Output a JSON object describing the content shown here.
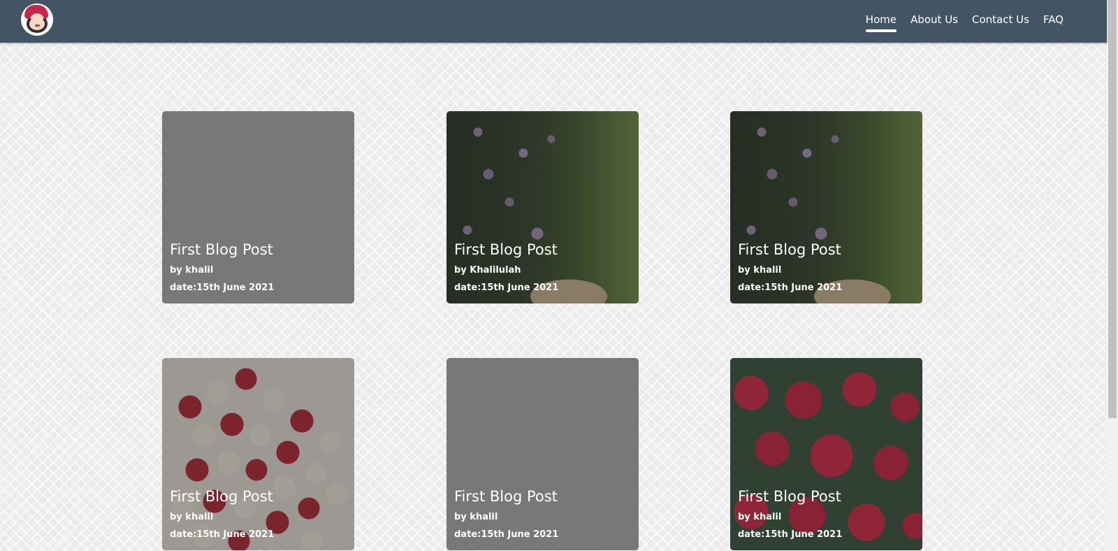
{
  "nav": {
    "logo_icon": "avatar-logo-icon",
    "links": [
      {
        "label": "Home",
        "active": true
      },
      {
        "label": "About Us",
        "active": false
      },
      {
        "label": "Contact Us",
        "active": false
      },
      {
        "label": "FAQ",
        "active": false
      }
    ]
  },
  "posts": [
    {
      "title": "First Blog Post",
      "author": "by khalil",
      "date": "date:15th June 2021",
      "image": "none"
    },
    {
      "title": "First Blog Post",
      "author": "by Khalilulah",
      "date": "date:15th June 2021",
      "image": "garden"
    },
    {
      "title": "First Blog Post",
      "author": "by khalil",
      "date": "date:15th June 2021",
      "image": "garden"
    },
    {
      "title": "First Blog Post",
      "author": "by khalil",
      "date": "date:15th June 2021",
      "image": "white-red-roses"
    },
    {
      "title": "First Blog Post",
      "author": "by khalil",
      "date": "date:15th June 2021",
      "image": "none"
    },
    {
      "title": "First Blog Post",
      "author": "by khalil",
      "date": "date:15th June 2021",
      "image": "red-roses"
    }
  ],
  "colors": {
    "navbar": "#435465",
    "page_background": "#ececec",
    "text": "#ffffff"
  }
}
